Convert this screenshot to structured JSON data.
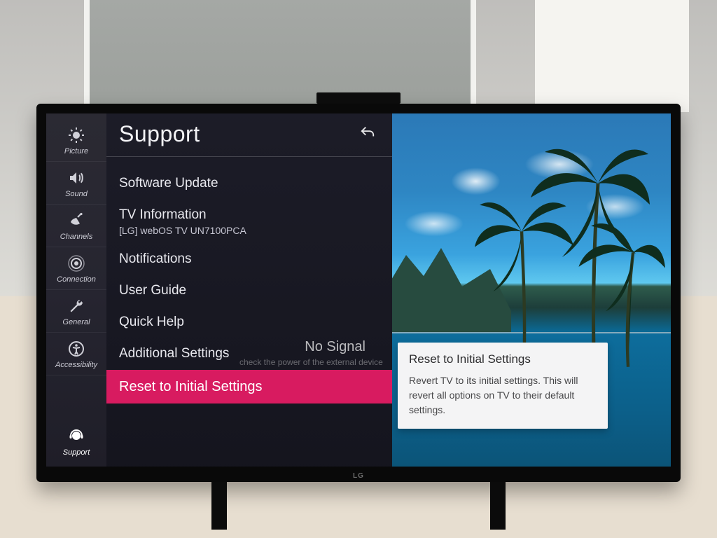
{
  "brand": "LG",
  "rail": {
    "items": [
      {
        "key": "picture",
        "label": "Picture"
      },
      {
        "key": "sound",
        "label": "Sound"
      },
      {
        "key": "channels",
        "label": "Channels"
      },
      {
        "key": "connection",
        "label": "Connection"
      },
      {
        "key": "general",
        "label": "General"
      },
      {
        "key": "accessibility",
        "label": "Accessibility"
      },
      {
        "key": "support",
        "label": "Support"
      }
    ],
    "active": "support"
  },
  "panel": {
    "title": "Support",
    "items": [
      {
        "label": "Software Update"
      },
      {
        "label": "TV Information",
        "sub": "[LG] webOS TV UN7100PCA"
      },
      {
        "label": "Notifications"
      },
      {
        "label": "User Guide"
      },
      {
        "label": "Quick Help"
      },
      {
        "label": "Additional Settings"
      },
      {
        "label": "Reset to Initial Settings",
        "selected": true
      }
    ]
  },
  "no_signal": {
    "title": "No Signal",
    "hint": "check the power of the external device"
  },
  "desc": {
    "title": "Reset to Initial Settings",
    "body": "Revert TV to its initial settings. This will revert all options on TV to their default settings."
  }
}
